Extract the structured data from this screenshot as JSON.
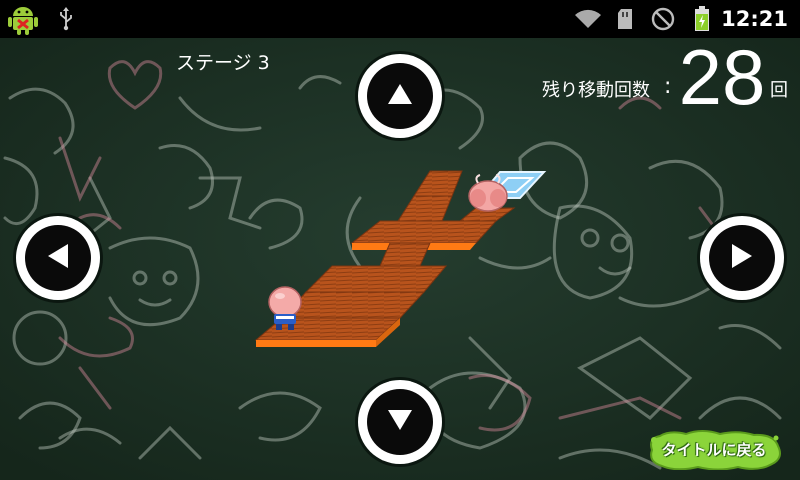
{
  "status_bar": {
    "time": "12:21",
    "icons": [
      "android-debug-icon",
      "usb-icon",
      "wifi-icon",
      "sd-card-icon",
      "no-sim-icon",
      "battery-charging-icon"
    ]
  },
  "hud": {
    "stage_label": "ステージ 3",
    "moves_label": "残り移動回数",
    "moves_separator": ":",
    "moves_count": "28",
    "moves_unit": "回"
  },
  "controls": {
    "up": "up-arrow-icon",
    "down": "down-arrow-icon",
    "left": "left-arrow-icon",
    "right": "right-arrow-icon",
    "title_button_label": "タイトルに戻る"
  },
  "colors": {
    "chalkboard": "#1f3327",
    "tile_top": "#b8531c",
    "tile_side": "#ff7a14",
    "goal": "#8ecff5",
    "button_green": "#8bd43a"
  }
}
